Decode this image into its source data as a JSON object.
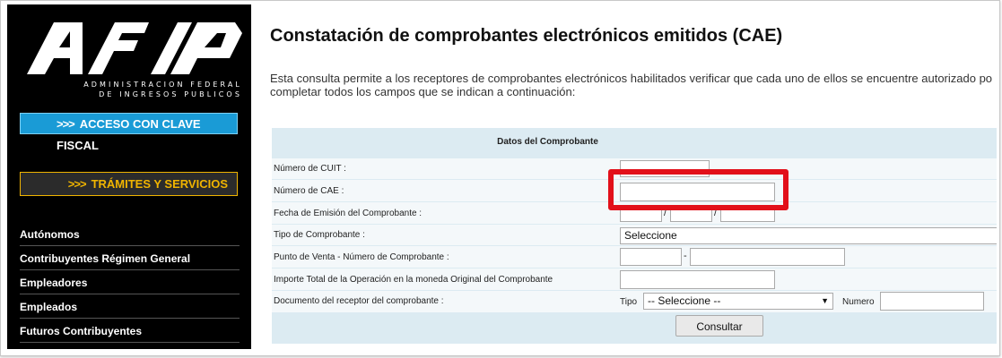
{
  "sidebar": {
    "logo": {
      "sub1": "ADMINISTRACION FEDERAL",
      "sub2": "DE INGRESOS PUBLICOS"
    },
    "btn_clave": "ACCESO CON CLAVE FISCAL",
    "btn_tramites": "TRÁMITES Y SERVICIOS",
    "arrow": ">>>",
    "nav": [
      "Autónomos",
      "Contribuyentes Régimen General",
      "Empleadores",
      "Empleados",
      "Futuros Contribuyentes"
    ]
  },
  "main": {
    "title": "Constatación de comprobantes electrónicos emitidos (CAE)",
    "intro_line1": "Esta consulta permite a los receptores de comprobantes electrónicos habilitados verificar que cada uno de ellos se encuentre autorizado po",
    "intro_line2": "completar todos los campos que se indican a continuación:"
  },
  "form": {
    "header": "Datos del Comprobante",
    "cuit_label": "Número de CUIT :",
    "cae_label": "Número de CAE :",
    "fecha_label": "Fecha de Emisión del Comprobante :",
    "tipo_comp_label": "Tipo de Comprobante :",
    "tipo_comp_value": "Seleccione",
    "pv_label": "Punto de Venta - Número de Comprobante :",
    "pv_sep": "-",
    "date_sep": "/",
    "importe_label": "Importe Total de la Operación en la moneda Original del Comprobante",
    "doc_label": "Documento del receptor del comprobante :",
    "doc_tipo_label": "Tipo",
    "doc_tipo_value": "-- Seleccione --",
    "doc_numero_label": "Numero",
    "submit": "Consultar"
  },
  "colors": {
    "highlight": "#e2101a",
    "clave_button": "#1a9bd6",
    "tramites_border": "#f0b400",
    "form_bg": "#dcebf2"
  }
}
